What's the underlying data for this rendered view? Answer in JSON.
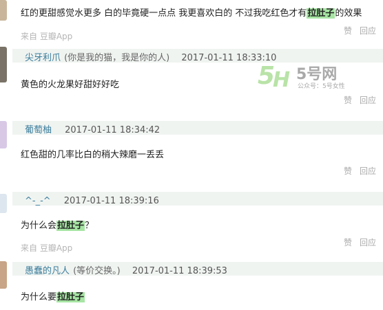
{
  "comments": [
    {
      "body_parts": [
        "红的更甜感觉水更多 白的毕竟硬一点点 我更喜欢白的 不过我吃红色才有",
        "拉肚子",
        "的效果"
      ],
      "source": "来自 豆瓣App",
      "like": "赞",
      "reply": "回应"
    },
    {
      "author": "尖牙利爪",
      "signature": "(你是我的猫，我是你的人)",
      "time": "2017-01-11 18:33:10",
      "body": "黄色的火龙果好甜好好吃",
      "like": "赞",
      "reply": "回应"
    },
    {
      "author": "葡萄柚",
      "time": "2017-01-11 18:34:42",
      "body": "红色甜的几率比白的稍大辣磨一丢丢",
      "like": "赞",
      "reply": "回应"
    },
    {
      "author": "^-_-^",
      "time": "2017-01-11 18:39:16",
      "body_parts": [
        "为什么会",
        "拉肚子",
        "？"
      ],
      "source": "来自 豆瓣App",
      "like": "赞",
      "reply": "回应"
    },
    {
      "author": "愚蠢的凡人",
      "signature": "(等价交换。)",
      "time": "2017-01-11 18:39:53",
      "body_parts": [
        "为什么要",
        "拉肚子"
      ]
    }
  ],
  "watermark": {
    "brand": "5号网",
    "subtitle": "公众号：5号女性",
    "colors": {
      "logo": "#8fd17a",
      "text": "#6b6b6b"
    }
  }
}
